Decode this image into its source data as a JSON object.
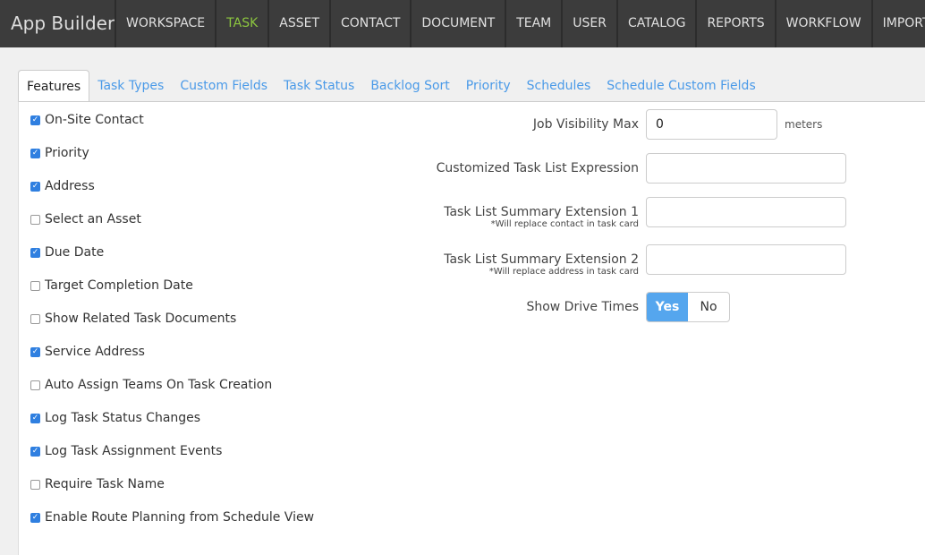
{
  "header": {
    "brand": "App Builder",
    "nav": [
      {
        "label": "WORKSPACE",
        "active": false
      },
      {
        "label": "TASK",
        "active": true
      },
      {
        "label": "ASSET",
        "active": false
      },
      {
        "label": "CONTACT",
        "active": false
      },
      {
        "label": "DOCUMENT",
        "active": false
      },
      {
        "label": "TEAM",
        "active": false
      },
      {
        "label": "USER",
        "active": false
      },
      {
        "label": "CATALOG",
        "active": false
      },
      {
        "label": "REPORTS",
        "active": false
      },
      {
        "label": "WORKFLOW",
        "active": false
      },
      {
        "label": "IMPORT",
        "active": false
      }
    ]
  },
  "tabs": [
    {
      "label": "Features",
      "active": true
    },
    {
      "label": "Task Types"
    },
    {
      "label": "Custom Fields"
    },
    {
      "label": "Task Status"
    },
    {
      "label": "Backlog Sort"
    },
    {
      "label": "Priority"
    },
    {
      "label": "Schedules"
    },
    {
      "label": "Schedule Custom Fields"
    }
  ],
  "features": [
    {
      "label": "On-Site Contact",
      "checked": true
    },
    {
      "label": "Priority",
      "checked": true
    },
    {
      "label": "Address",
      "checked": true
    },
    {
      "label": "Select an Asset",
      "checked": false
    },
    {
      "label": "Due Date",
      "checked": true
    },
    {
      "label": "Target Completion Date",
      "checked": false
    },
    {
      "label": "Show Related Task Documents",
      "checked": false
    },
    {
      "label": "Service Address",
      "checked": true
    },
    {
      "label": "Auto Assign Teams On Task Creation",
      "checked": false
    },
    {
      "label": "Log Task Status Changes",
      "checked": true
    },
    {
      "label": "Log Task Assignment Events",
      "checked": true
    },
    {
      "label": "Require Task Name",
      "checked": false
    },
    {
      "label": "Enable Route Planning from Schedule View",
      "checked": true
    }
  ],
  "settings": {
    "job_visibility": {
      "label": "Job Visibility Max",
      "value": "0",
      "unit": "meters"
    },
    "task_list_expression": {
      "label": "Customized Task List Expression",
      "value": ""
    },
    "summary_ext1": {
      "label": "Task List Summary Extension 1",
      "note": "*Will replace contact in task card",
      "value": ""
    },
    "summary_ext2": {
      "label": "Task List Summary Extension 2",
      "note": "*Will replace address in task card",
      "value": ""
    },
    "drive_times": {
      "label": "Show Drive Times",
      "yes": "Yes",
      "no": "No",
      "selected": "Yes"
    }
  },
  "colors": {
    "accent": "#4a9ae8",
    "active_nav": "#8cc63f",
    "toggle_on": "#55a6ee"
  }
}
